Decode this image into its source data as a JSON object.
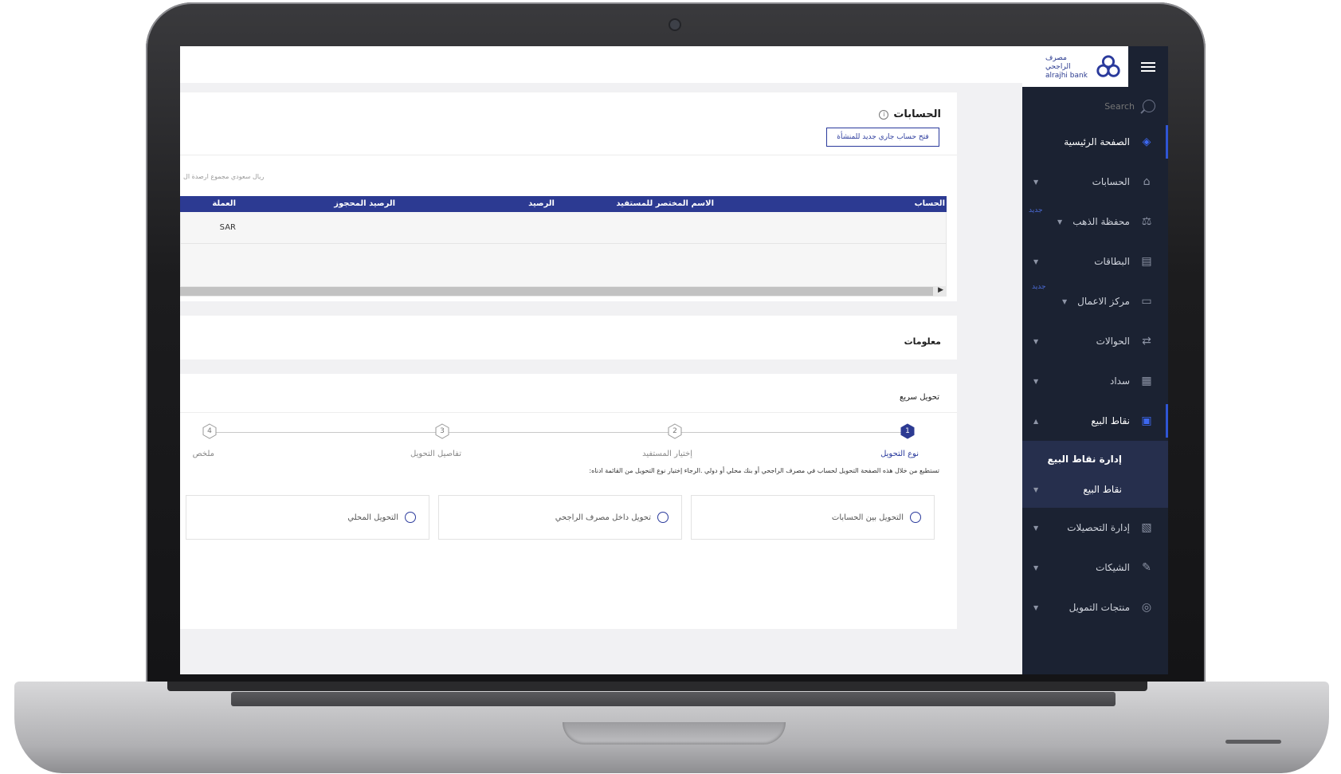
{
  "brand": {
    "logo_ar": "مصرف الراجحي",
    "logo_en": "alrajhi bank",
    "primary_color": "#2c3a92",
    "sidebar_color": "#1b2232"
  },
  "sidebar": {
    "search_placeholder": "Search",
    "items": [
      {
        "label": "الصفحة الرئيسية",
        "icon": "layers-icon"
      },
      {
        "label": "الحسابات",
        "icon": "bank-icon"
      },
      {
        "label": "محفظة الذهب",
        "icon": "gold-icon",
        "tag": "جديد"
      },
      {
        "label": "البطاقات",
        "icon": "cards-icon"
      },
      {
        "label": "مركز الاعمال",
        "icon": "card-icon",
        "tag": "جديد"
      },
      {
        "label": "الحوالات",
        "icon": "transfer-icon"
      },
      {
        "label": "سداد",
        "icon": "sadad-icon"
      },
      {
        "label": "نقاط البيع",
        "icon": "pos-icon"
      },
      {
        "label": "إدارة التحصيلات",
        "icon": "collections-icon"
      },
      {
        "label": "الشيكات",
        "icon": "cheque-icon"
      },
      {
        "label": "منتجات التمويل",
        "icon": "finance-icon"
      }
    ],
    "submenu": {
      "header": "إدارة نقاط البيع",
      "item": "نقاط البيع"
    }
  },
  "accounts": {
    "title": "الحسابات",
    "open_button": "فتح حساب جاري جديد للمنشأة",
    "summary_text": "ريال سعودي مجموع ارصدة ال",
    "columns": [
      "الحساب",
      "الاسم المختصر للمستفيد",
      "الرصيد",
      "الرصيد المحجوز",
      "العملة"
    ],
    "rows": [
      {
        "currency": "SAR"
      }
    ]
  },
  "info": {
    "title": "معلومات"
  },
  "quick_transfer": {
    "title": "تحويل سريع",
    "steps": [
      {
        "num": "1",
        "label": "نوع التحويل",
        "active": true
      },
      {
        "num": "2",
        "label": "إختيار المستفيد",
        "active": false
      },
      {
        "num": "3",
        "label": "تفاصيل التحويل",
        "active": false
      },
      {
        "num": "4",
        "label": "ملخص",
        "active": false
      }
    ],
    "description": "تستطيع من خلال هذه الصفحة التحويل لحساب في مصرف الراجحي أو بنك محلي أو دولي .الرجاء إختيار نوع التحويل من القائمة ادناه:",
    "options": [
      "التحويل بين الحسابات",
      "تحويل داخل مصرف الراجحي",
      "التحويل المحلي"
    ]
  }
}
